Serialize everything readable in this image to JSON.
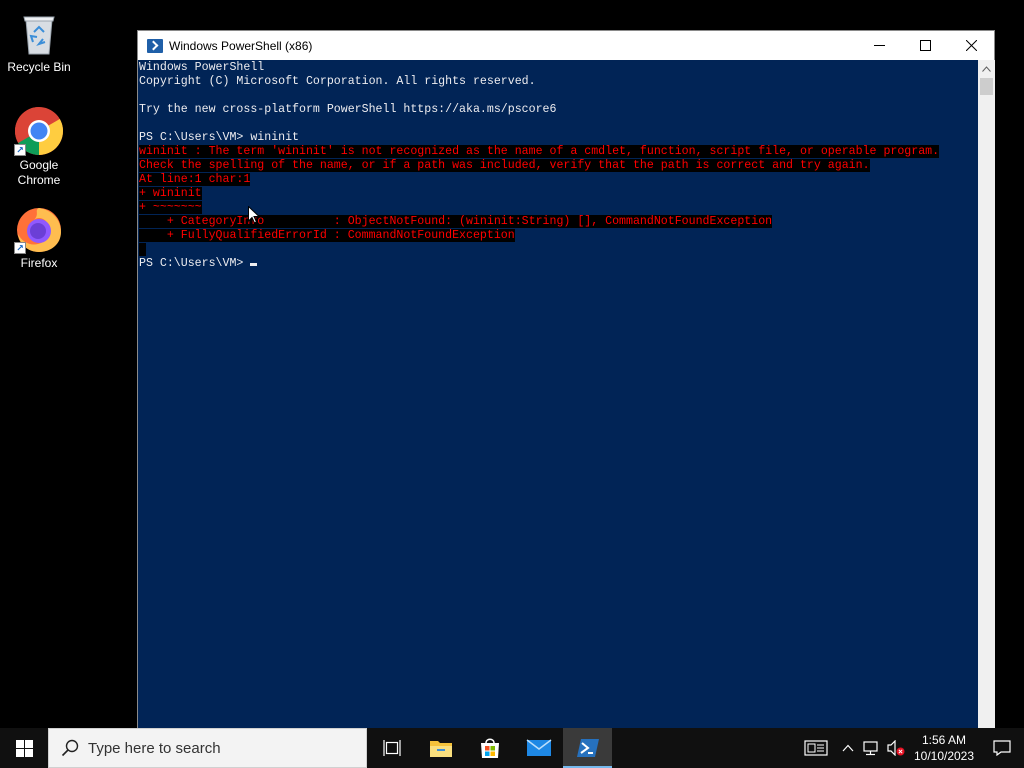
{
  "desktop": {
    "icons": [
      {
        "label": "Recycle Bin"
      },
      {
        "label": "Google Chrome"
      },
      {
        "label": "Firefox"
      }
    ]
  },
  "window": {
    "title": "Windows PowerShell (x86)",
    "console": {
      "lines": [
        {
          "text": "Windows PowerShell",
          "type": "normal"
        },
        {
          "text": "Copyright (C) Microsoft Corporation. All rights reserved.",
          "type": "normal"
        },
        {
          "text": "",
          "type": "normal"
        },
        {
          "text": "Try the new cross-platform PowerShell https://aka.ms/pscore6",
          "type": "normal"
        },
        {
          "text": "",
          "type": "normal"
        },
        {
          "text": "PS C:\\Users\\VM> wininit",
          "type": "normal"
        },
        {
          "text": "wininit : The term 'wininit' is not recognized as the name of a cmdlet, function, script file, or operable program.",
          "type": "error"
        },
        {
          "text": "Check the spelling of the name, or if a path was included, verify that the path is correct and try again.",
          "type": "error"
        },
        {
          "text": "At line:1 char:1",
          "type": "error"
        },
        {
          "text": "+ wininit",
          "type": "error"
        },
        {
          "text": "+ ~~~~~~~",
          "type": "error"
        },
        {
          "text": "    + CategoryInfo          : ObjectNotFound: (wininit:String) [], CommandNotFoundException",
          "type": "error"
        },
        {
          "text": "    + FullyQualifiedErrorId : CommandNotFoundException",
          "type": "error"
        },
        {
          "text": " ",
          "type": "error"
        },
        {
          "text": "PS C:\\Users\\VM> ",
          "type": "prompt"
        }
      ]
    }
  },
  "taskbar": {
    "search_placeholder": "Type here to search",
    "apps": [
      {
        "icon": "task-view-icon"
      },
      {
        "icon": "file-explorer-icon"
      },
      {
        "icon": "microsoft-store-icon"
      },
      {
        "icon": "mail-icon"
      },
      {
        "icon": "powershell-icon",
        "active": true
      }
    ],
    "clock": {
      "time": "1:56 AM",
      "date": "10/10/2023"
    }
  },
  "colors": {
    "console_bg": "#012456",
    "console_fg": "#eeedf0",
    "error_fg": "#ff0000",
    "taskbar_bg": "#101010",
    "active_indicator": "#76b9ed"
  }
}
